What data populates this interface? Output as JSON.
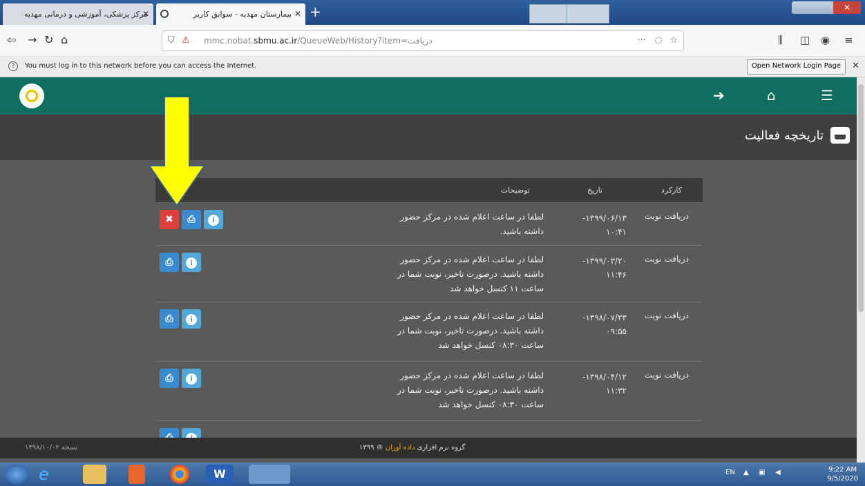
{
  "browser": {
    "tabs": [
      {
        "title": "مرکز پزشکی، آموزشی و درمانی مهدیه"
      },
      {
        "title": "بیمارستان مهدیه - سوابق کاربر"
      }
    ],
    "new_tab": "+",
    "url_pre": "mmc.nobat.",
    "url_host": "sbmu.ac.ir",
    "url_post": "/QueueWeb/History?item=دریافت",
    "notification": "You must log in to this network before you can access the Internet.",
    "notification_button": "Open Network Login Page"
  },
  "app": {
    "page_title": "تاریخچه فعالیت",
    "table": {
      "headers": {
        "function": "کارکرد",
        "date": "تاریخ",
        "description": "توضیحات"
      },
      "rows": [
        {
          "function": "دریافت نوبت",
          "date": "۱۳۹۹/۰۶/۱۳- ۱۰:۴۱",
          "description": "لطفا در ساعت اعلام شده در مرکز حضور داشته باشید.",
          "has_delete": true
        },
        {
          "function": "دریافت نوبت",
          "date": "۱۳۹۹/۰۳/۲۰- ۱۱:۴۶",
          "description": "لطفا در ساعت اعلام شده در مرکز حضور داشته باشید. درصورت تاخیر، نوبت شما در ساعت ۱۱ کنسل خواهد شد",
          "has_delete": false
        },
        {
          "function": "دریافت نوبت",
          "date": "۱۳۹۸/۰۷/۲۳- ۰۹:۵۵",
          "description": "لطفا در ساعت اعلام شده در مرکز حضور داشته باشید. درصورت تاخیر، نوبت شما در ساعت ۰۸:۳۰ کنسل خواهد شد",
          "has_delete": false
        },
        {
          "function": "دریافت نوبت",
          "date": "۱۳۹۸/۰۴/۱۲- ۱۱:۳۲",
          "description": "لطفا در ساعت اعلام شده در مرکز حضور داشته باشید. درصورت تاخیر، نوبت شما در ساعت ۰۸:۳۰ کنسل خواهد شد",
          "has_delete": false
        }
      ]
    },
    "footer_prefix": "گروه نرم افزاری",
    "footer_brand": "داده آوران",
    "footer_year": "® ۱۳۹۹",
    "version": "نسخه ۱۳۹۸/۱۰/۰۲"
  },
  "taskbar": {
    "lang": "EN",
    "time": "9:22 AM",
    "date": "9/5/2020"
  },
  "colors": {
    "header": "#0f6e60",
    "delete": "#e0403b",
    "print": "#3a8ad0",
    "info": "#52a8d8",
    "arrow": "#ffff00"
  }
}
